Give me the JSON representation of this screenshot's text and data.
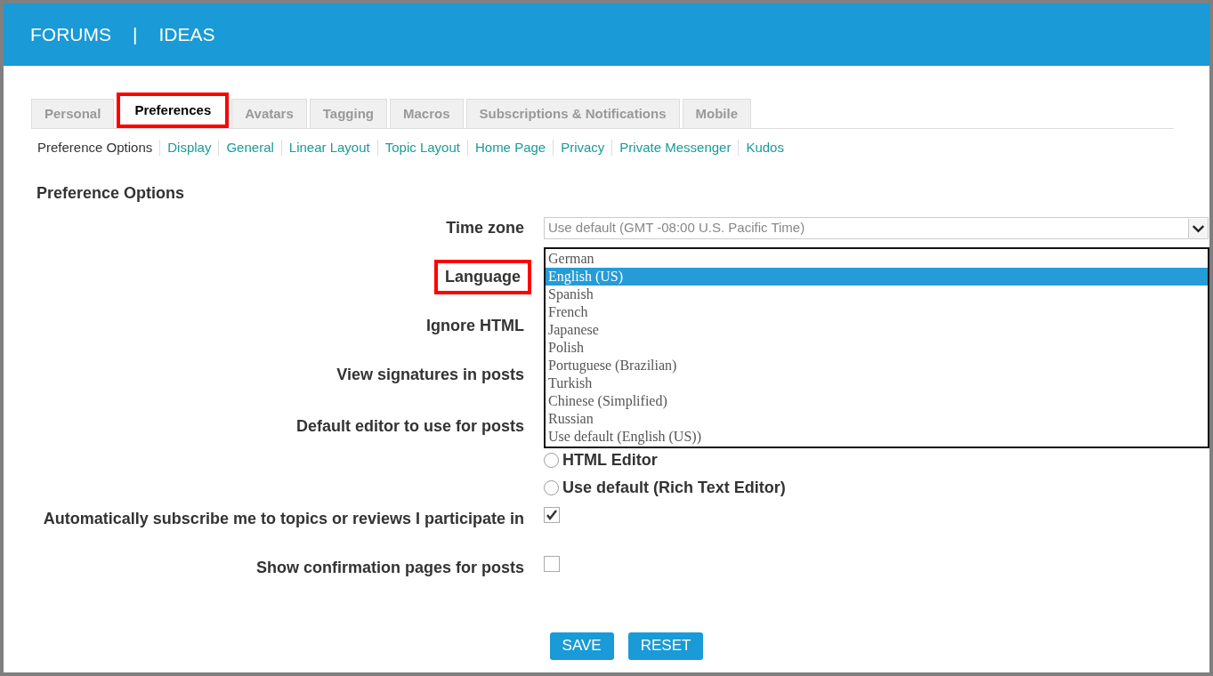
{
  "header": {
    "links": [
      "FORUMS",
      "IDEAS"
    ],
    "separator": "|"
  },
  "tabs": [
    {
      "label": "Personal",
      "selected": false,
      "highlighted": false
    },
    {
      "label": "Preferences",
      "selected": true,
      "highlighted": true
    },
    {
      "label": "Avatars",
      "selected": false,
      "highlighted": false
    },
    {
      "label": "Tagging",
      "selected": false,
      "highlighted": false
    },
    {
      "label": "Macros",
      "selected": false,
      "highlighted": false
    },
    {
      "label": "Subscriptions & Notifications",
      "selected": false,
      "highlighted": false
    },
    {
      "label": "Mobile",
      "selected": false,
      "highlighted": false
    }
  ],
  "subnav": [
    {
      "label": "Preference Options",
      "selected": true
    },
    {
      "label": "Display",
      "selected": false
    },
    {
      "label": "General",
      "selected": false
    },
    {
      "label": "Linear Layout",
      "selected": false
    },
    {
      "label": "Topic Layout",
      "selected": false
    },
    {
      "label": "Home Page",
      "selected": false
    },
    {
      "label": "Privacy",
      "selected": false
    },
    {
      "label": "Private Messenger",
      "selected": false
    },
    {
      "label": "Kudos",
      "selected": false
    }
  ],
  "heading": "Preference Options",
  "time_zone": {
    "label": "Time zone",
    "value": "Use default (GMT -08:00 U.S. Pacific Time)"
  },
  "language": {
    "label": "Language",
    "highlighted": true,
    "options": [
      {
        "label": "German",
        "selected": false
      },
      {
        "label": "English (US)",
        "selected": true
      },
      {
        "label": "Spanish",
        "selected": false
      },
      {
        "label": "French",
        "selected": false
      },
      {
        "label": "Japanese",
        "selected": false
      },
      {
        "label": "Polish",
        "selected": false
      },
      {
        "label": "Portuguese (Brazilian)",
        "selected": false
      },
      {
        "label": "Turkish",
        "selected": false
      },
      {
        "label": "Chinese (Simplified)",
        "selected": false
      },
      {
        "label": "Russian",
        "selected": false
      },
      {
        "label": "Use default (English (US))",
        "selected": false
      }
    ]
  },
  "ignore_html": {
    "label": "Ignore HTML"
  },
  "signatures": {
    "label": "View signatures in posts"
  },
  "editor": {
    "label": "Default editor to use for posts",
    "options": [
      {
        "label": "HTML Editor",
        "selected": false
      },
      {
        "label": "Use default (Rich Text Editor)",
        "selected": false
      }
    ]
  },
  "checkboxes": [
    {
      "label": "Automatically subscribe me to topics or reviews I participate in",
      "checked": true
    },
    {
      "label": "Show confirmation pages for posts",
      "checked": false
    }
  ],
  "buttons": [
    "SAVE",
    "RESET"
  ]
}
